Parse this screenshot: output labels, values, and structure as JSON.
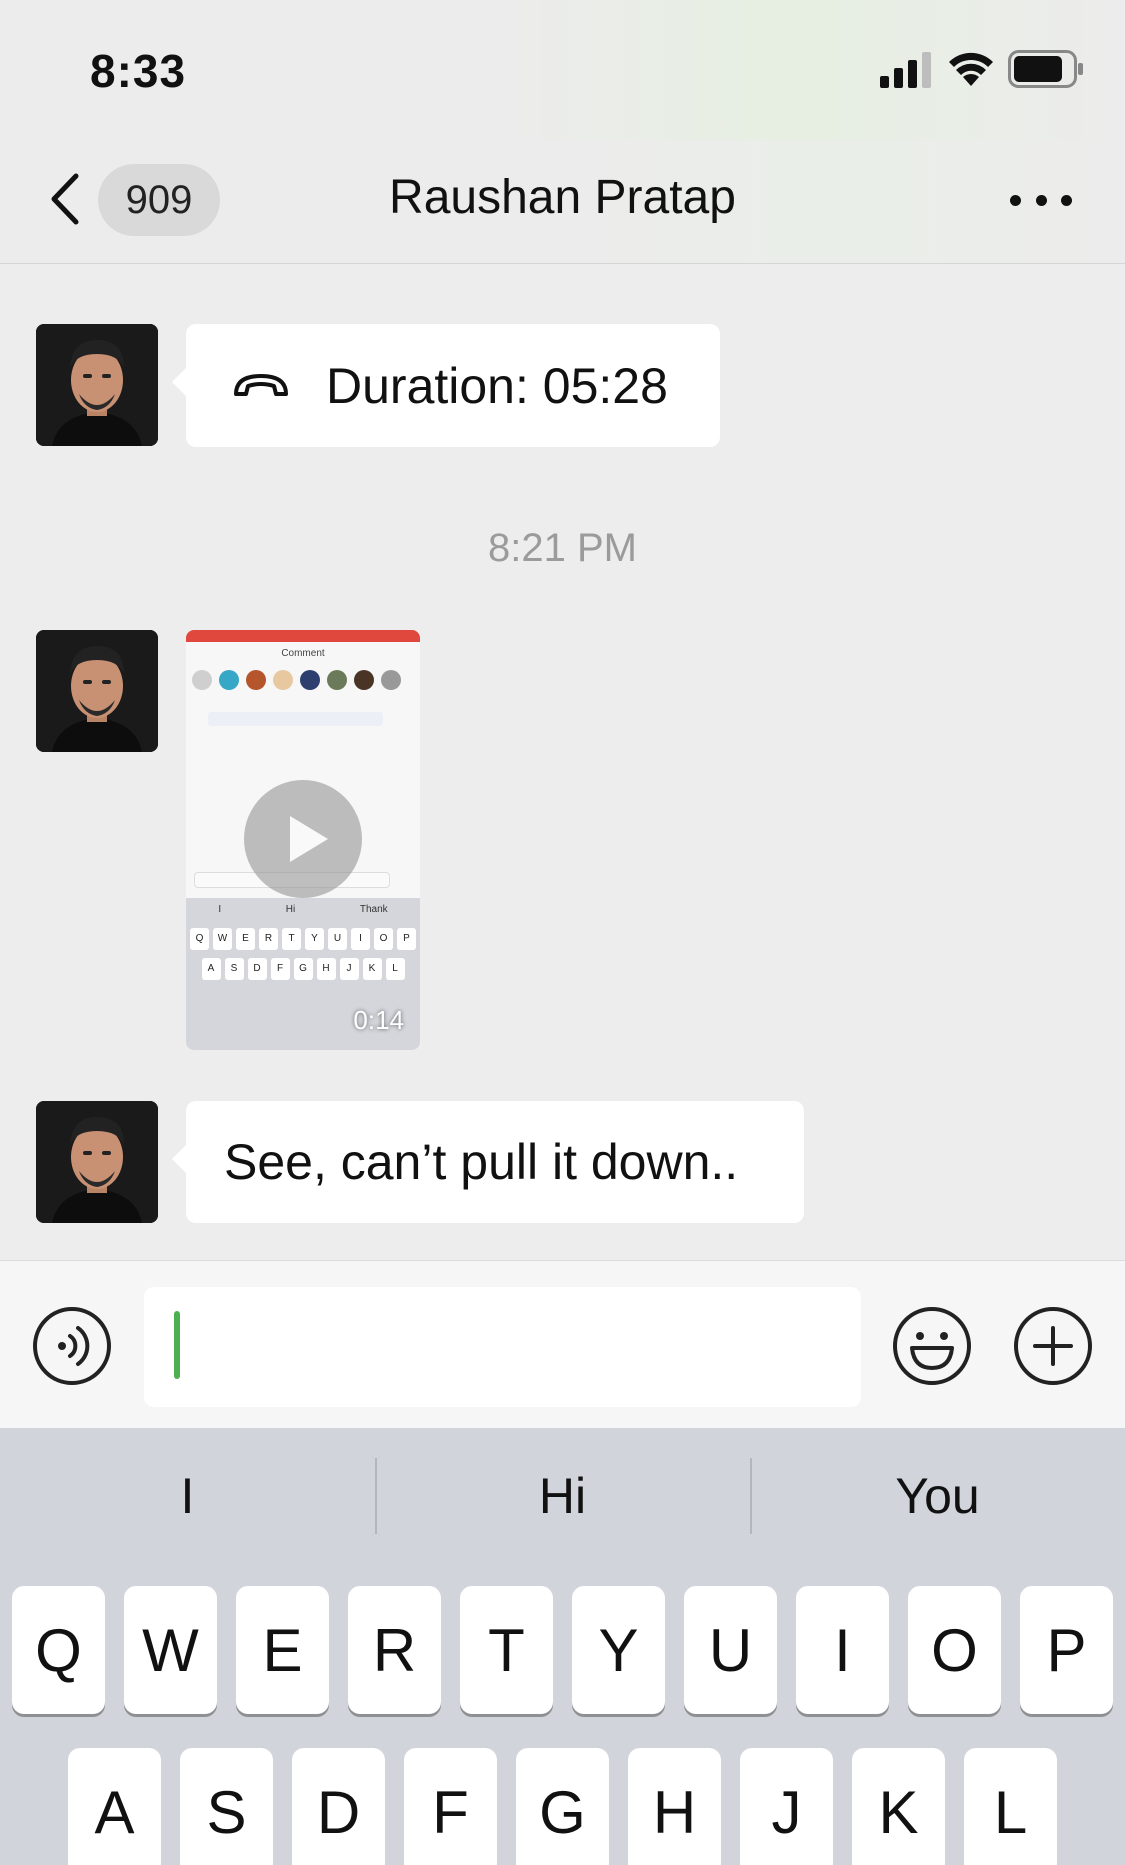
{
  "status_bar": {
    "time": "8:33"
  },
  "nav": {
    "unread_count": "909",
    "title": "Raushan Pratap"
  },
  "messages": {
    "call": {
      "text": "Duration: 05:28"
    },
    "timestamp": "8:21 PM",
    "video": {
      "duration": "0:14",
      "header": "Comment",
      "suggestions": [
        "I",
        "Hi",
        "Thank"
      ]
    },
    "text": {
      "text": "See, can’t pull it down.."
    }
  },
  "input": {
    "value": ""
  },
  "keyboard": {
    "suggestions": [
      "I",
      "Hi",
      "You"
    ],
    "row1": [
      "Q",
      "W",
      "E",
      "R",
      "T",
      "Y",
      "U",
      "I",
      "O",
      "P"
    ],
    "row2": [
      "A",
      "S",
      "D",
      "F",
      "G",
      "H",
      "J",
      "K",
      "L"
    ]
  },
  "colors": {
    "caret": "#4caf50",
    "bubble": "#ffffff",
    "background": "#ededed"
  }
}
